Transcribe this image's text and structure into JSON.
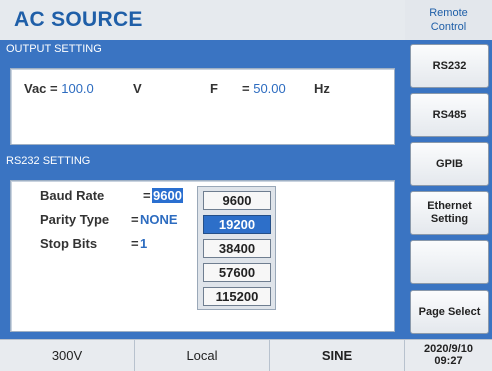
{
  "header": {
    "title": "AC SOURCE",
    "remote_control": "Remote Control"
  },
  "output_setting": {
    "section_title": "OUTPUT SETTING",
    "vac_label": "Vac = ",
    "vac_value": "100.0",
    "vac_unit": "V",
    "freq_label": "F",
    "freq_eq": "= ",
    "freq_value": "50.00",
    "freq_unit": "Hz"
  },
  "rs232_setting": {
    "section_title": "RS232 SETTING",
    "baud_rate_label": "Baud Rate",
    "baud_rate_value": "9600",
    "parity_type_label": "Parity Type",
    "parity_type_value": "NONE",
    "stop_bits_label": "Stop Bits",
    "stop_bits_value": "1",
    "eq": "="
  },
  "baud_options": [
    "9600",
    "19200",
    "38400",
    "57600",
    "115200"
  ],
  "baud_selected": "19200",
  "side_buttons": {
    "rs232": "RS232",
    "rs485": "RS485",
    "gpib": "GPIB",
    "ethernet": "Ethernet Setting",
    "blank": "",
    "page_select": "Page Select"
  },
  "status_bar": {
    "range": "300V",
    "mode": "Local",
    "waveform": "SINE",
    "date": "2020/9/10",
    "time": "09:27"
  },
  "colors": {
    "accent": "#3a74c2",
    "title": "#1f5fa8",
    "value": "#2d6cc0",
    "selected": "#2d6fc9"
  }
}
